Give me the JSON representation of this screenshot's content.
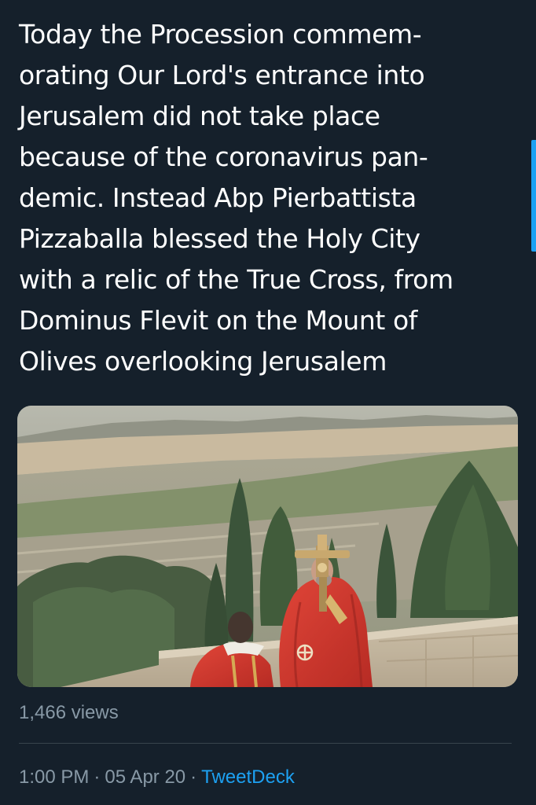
{
  "tweet": {
    "text_lines": [
      "Today the Procession commem-",
      "orating Our Lord's entrance into",
      "Jerusalem did not take place",
      "because of the coronavirus pan-",
      "demic. Instead Abp Pierbattista",
      "Pizzaballa blessed the Holy City",
      "with a relic of the True Cross, from",
      "Dominus Flevit on the Mount of",
      "Olives overlooking Jerusalem"
    ],
    "views": "1,466 views",
    "time": "1:00 PM",
    "separator": "·",
    "date": "05 Apr 20",
    "source": "TweetDeck"
  },
  "colors": {
    "background": "#15202b",
    "text": "#ffffff",
    "secondary_text": "#8899a6",
    "link": "#1da1f2",
    "divider": "#38444d"
  }
}
